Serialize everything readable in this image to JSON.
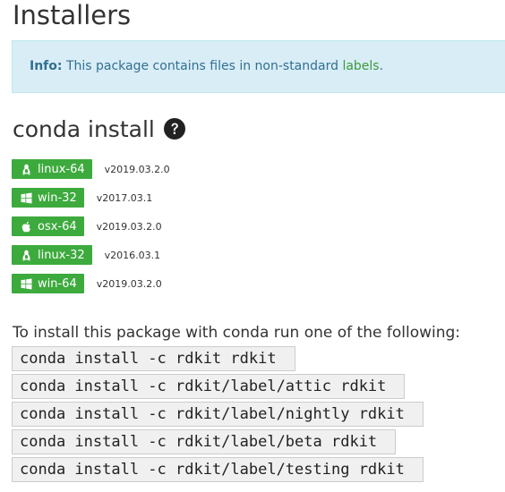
{
  "page": {
    "title": "Installers"
  },
  "info": {
    "label": "Info:",
    "text": "This package contains files in non-standard",
    "link": "labels",
    "suffix": "."
  },
  "conda_section": {
    "title": "conda install",
    "help_icon": "question-circle-icon"
  },
  "platforms": [
    {
      "label": "linux-64",
      "icon": "linux-icon",
      "version": "v2019.03.2.0"
    },
    {
      "label": "win-32",
      "icon": "windows-icon",
      "version": "v2017.03.1"
    },
    {
      "label": "osx-64",
      "icon": "apple-icon",
      "version": "v2019.03.2.0"
    },
    {
      "label": "linux-32",
      "icon": "linux-icon",
      "version": "v2016.03.1"
    },
    {
      "label": "win-64",
      "icon": "windows-icon",
      "version": "v2019.03.2.0"
    }
  ],
  "install": {
    "instructions": "To install this package with conda run one of the following:",
    "commands": [
      "conda install -c rdkit rdkit",
      "conda install -c rdkit/label/attic rdkit",
      "conda install -c rdkit/label/nightly rdkit",
      "conda install -c rdkit/label/beta rdkit",
      "conda install -c rdkit/label/testing rdkit"
    ]
  },
  "colors": {
    "button_green": "#3daa3d",
    "info_background": "#d9edf7",
    "info_border": "#bce8f1",
    "link_green": "#3c9a3c",
    "code_background": "#f0f0f0"
  }
}
